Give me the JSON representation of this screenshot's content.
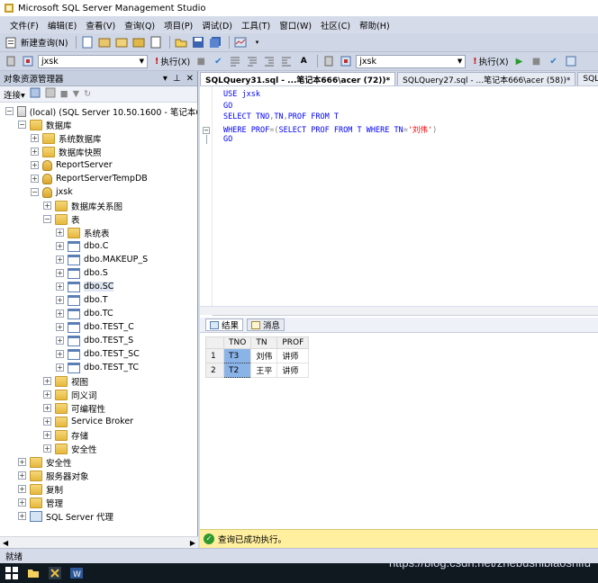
{
  "window": {
    "title": "Microsoft SQL Server Management Studio"
  },
  "menu": [
    "文件(F)",
    "编辑(E)",
    "查看(V)",
    "查询(Q)",
    "项目(P)",
    "调试(D)",
    "工具(T)",
    "窗口(W)",
    "社区(C)",
    "帮助(H)"
  ],
  "toolbar1": {
    "new_query": "新建查询(N)"
  },
  "toolbar2": {
    "db_left": "jxsk",
    "exec_left": "执行(X)",
    "db_right": "jxsk",
    "exec_right": "执行(X)"
  },
  "object_explorer": {
    "title": "对象资源管理器",
    "connect": "连接",
    "tree": [
      {
        "label": "(local) (SQL Server 10.50.1600 - 笔记本666\\",
        "indent": 0,
        "expander": "−",
        "icon": "server"
      },
      {
        "label": "数据库",
        "indent": 1,
        "expander": "−",
        "icon": "folder"
      },
      {
        "label": "系统数据库",
        "indent": 2,
        "expander": "+",
        "icon": "folder"
      },
      {
        "label": "数据库快照",
        "indent": 2,
        "expander": "+",
        "icon": "folder"
      },
      {
        "label": "ReportServer",
        "indent": 2,
        "expander": "+",
        "icon": "db"
      },
      {
        "label": "ReportServerTempDB",
        "indent": 2,
        "expander": "+",
        "icon": "db"
      },
      {
        "label": "jxsk",
        "indent": 2,
        "expander": "−",
        "icon": "db"
      },
      {
        "label": "数据库关系图",
        "indent": 3,
        "expander": "+",
        "icon": "folder"
      },
      {
        "label": "表",
        "indent": 3,
        "expander": "−",
        "icon": "folder"
      },
      {
        "label": "系统表",
        "indent": 4,
        "expander": "+",
        "icon": "folder"
      },
      {
        "label": "dbo.C",
        "indent": 4,
        "expander": "+",
        "icon": "table"
      },
      {
        "label": "dbo.MAKEUP_S",
        "indent": 4,
        "expander": "+",
        "icon": "table"
      },
      {
        "label": "dbo.S",
        "indent": 4,
        "expander": "+",
        "icon": "table"
      },
      {
        "label": "dbo.SC",
        "indent": 4,
        "expander": "+",
        "icon": "table",
        "selected": true
      },
      {
        "label": "dbo.T",
        "indent": 4,
        "expander": "+",
        "icon": "table"
      },
      {
        "label": "dbo.TC",
        "indent": 4,
        "expander": "+",
        "icon": "table"
      },
      {
        "label": "dbo.TEST_C",
        "indent": 4,
        "expander": "+",
        "icon": "table"
      },
      {
        "label": "dbo.TEST_S",
        "indent": 4,
        "expander": "+",
        "icon": "table"
      },
      {
        "label": "dbo.TEST_SC",
        "indent": 4,
        "expander": "+",
        "icon": "table"
      },
      {
        "label": "dbo.TEST_TC",
        "indent": 4,
        "expander": "+",
        "icon": "table"
      },
      {
        "label": "视图",
        "indent": 3,
        "expander": "+",
        "icon": "folder"
      },
      {
        "label": "同义词",
        "indent": 3,
        "expander": "+",
        "icon": "folder"
      },
      {
        "label": "可编程性",
        "indent": 3,
        "expander": "+",
        "icon": "folder"
      },
      {
        "label": "Service Broker",
        "indent": 3,
        "expander": "+",
        "icon": "folder"
      },
      {
        "label": "存储",
        "indent": 3,
        "expander": "+",
        "icon": "folder"
      },
      {
        "label": "安全性",
        "indent": 3,
        "expander": "+",
        "icon": "folder"
      },
      {
        "label": "安全性",
        "indent": 1,
        "expander": "+",
        "icon": "folder"
      },
      {
        "label": "服务器对象",
        "indent": 1,
        "expander": "+",
        "icon": "folder"
      },
      {
        "label": "复制",
        "indent": 1,
        "expander": "+",
        "icon": "folder"
      },
      {
        "label": "管理",
        "indent": 1,
        "expander": "+",
        "icon": "folder"
      },
      {
        "label": "SQL Server 代理",
        "indent": 1,
        "expander": "+",
        "icon": "agent"
      }
    ]
  },
  "tabs": [
    {
      "label": "SQLQuery31.sql - ...笔记本666\\acer (72))*",
      "active": true
    },
    {
      "label": "SQLQuery27.sql - ...笔记本666\\acer (58))*",
      "active": false
    },
    {
      "label": "SQLQuery2",
      "active": false
    }
  ],
  "editor": {
    "lines": [
      [
        {
          "t": "USE ",
          "c": "kw"
        },
        {
          "t": "jxsk",
          "c": "kw"
        }
      ],
      [
        {
          "t": "GO",
          "c": "kw"
        }
      ],
      [
        {
          "t": "SELECT ",
          "c": "kw"
        },
        {
          "t": "TNO",
          "c": "kw"
        },
        {
          "t": ",",
          "c": "op"
        },
        {
          "t": "TN",
          "c": "kw"
        },
        {
          "t": ",",
          "c": "op"
        },
        {
          "t": "PROF ",
          "c": "kw"
        },
        {
          "t": "FROM ",
          "c": "kw"
        },
        {
          "t": "T",
          "c": "kw"
        }
      ],
      [
        {
          "t": "WHERE ",
          "c": "kw"
        },
        {
          "t": "PROF",
          "c": "kw"
        },
        {
          "t": "=(",
          "c": "op"
        },
        {
          "t": "SELECT ",
          "c": "kw"
        },
        {
          "t": "PROF ",
          "c": "kw"
        },
        {
          "t": "FROM ",
          "c": "kw"
        },
        {
          "t": "T ",
          "c": "kw"
        },
        {
          "t": "WHERE ",
          "c": "kw"
        },
        {
          "t": "TN",
          "c": "kw"
        },
        {
          "t": "=",
          "c": "op"
        },
        {
          "t": "'刘伟'",
          "c": "str"
        },
        {
          "t": ")",
          "c": "op"
        }
      ],
      [
        {
          "t": "GO",
          "c": "kw"
        }
      ]
    ]
  },
  "results": {
    "tab_results": "结果",
    "tab_messages": "消息",
    "columns": [
      "TNO",
      "TN",
      "PROF"
    ],
    "rows": [
      {
        "num": "1",
        "cells": [
          "T3",
          "刘伟",
          "讲师"
        ]
      },
      {
        "num": "2",
        "cells": [
          "T2",
          "王平",
          "讲师"
        ]
      }
    ]
  },
  "query_status": "查询已成功执行。",
  "status": "就绪",
  "watermark": "https://blog.csdn.net/zhebushibiaoshifu"
}
